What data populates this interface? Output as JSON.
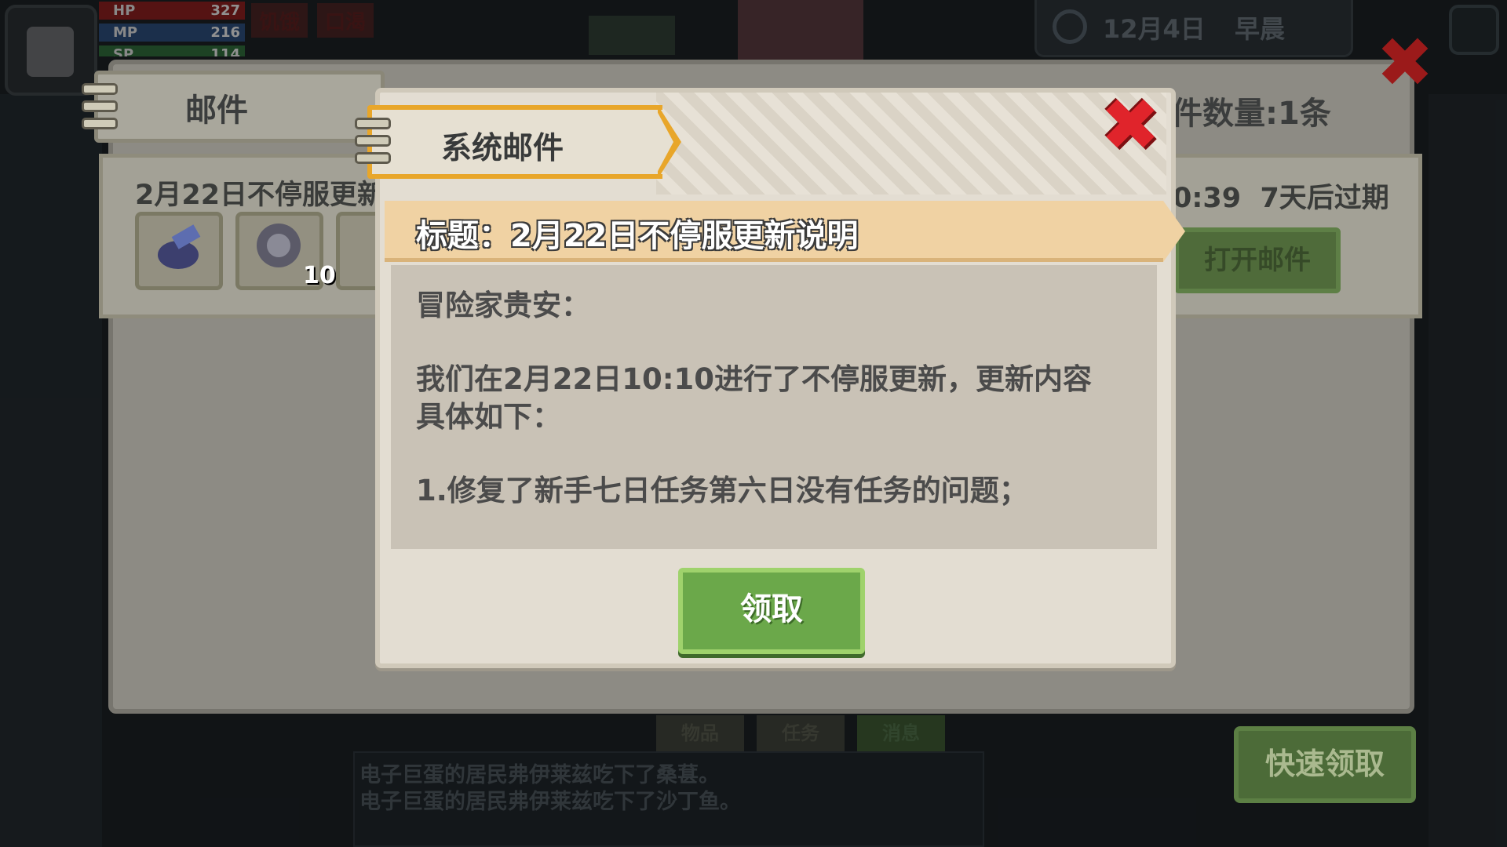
{
  "hud": {
    "hp_label": "HP",
    "hp_value": "327",
    "mp_label": "MP",
    "mp_value": "216",
    "sp_label": "SP",
    "sp_value": "114",
    "status_hunger": "饥饿",
    "status_thirst": "口渴",
    "date": "12月4日",
    "time_of_day": "早晨"
  },
  "mail_window": {
    "tab_label": "邮件",
    "mail_count": "邮件数量:1条",
    "list_item_title": "2月22日不停服更新",
    "list_item_time": "0:39",
    "list_item_expire": "7天后过期",
    "item_count": "10",
    "open_button": "打开邮件",
    "quick_claim": "快速领取"
  },
  "popup": {
    "tab_label": "系统邮件",
    "title": "标题：2月22日不停服更新说明",
    "greeting": "冒险家贵安：",
    "body_line1": "我们在2月22日10:10进行了不停服更新，更新内容",
    "body_line2": "具体如下：",
    "body_line3": "1.修复了新手七日任务第六日没有任务的问题；",
    "claim_button": "领取"
  },
  "bottom": {
    "tab_1": "物品",
    "tab_2": "任务",
    "tab_3": "消息",
    "log_line1": "电子巨蛋的居民弗伊莱兹吃下了桑葚。",
    "log_line2": "电子巨蛋的居民弗伊莱兹吃下了沙丁鱼。"
  },
  "colors": {
    "claim_green": "#6ba84a",
    "tab_orange": "#e8a62a",
    "close_red": "#e0242b",
    "ribbon_tan": "#f0d2a3"
  },
  "icons": [
    "close-icon",
    "sun-icon",
    "scroll-item-icon",
    "gear-item-icon",
    "gem-item-icon"
  ]
}
